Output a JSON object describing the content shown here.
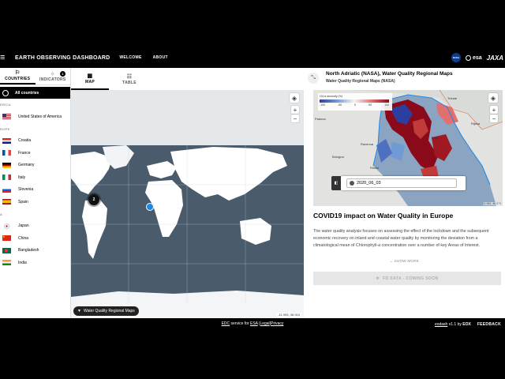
{
  "header": {
    "title": "EARTH OBSERVING DASHBOARD",
    "nav": [
      "WELCOME",
      "ABOUT"
    ],
    "menu_icon": "hamburger-icon",
    "logos": {
      "nasa": "NASA",
      "esa": "esa",
      "jaxa": "JAXA"
    }
  },
  "sidebar": {
    "tabs": [
      {
        "label": "COUNTRIES",
        "icon": "flag-icon"
      },
      {
        "label": "INDICATORS",
        "icon": "lightbulb-icon",
        "badge": "1"
      }
    ],
    "all_label": "All countries",
    "regions": [
      {
        "label": "ERICA",
        "items": [
          {
            "name": "United States of America",
            "flag": "us"
          }
        ]
      },
      {
        "label": "ROPE",
        "items": [
          {
            "name": "Croatia",
            "flag": "hr"
          },
          {
            "name": "France",
            "flag": "fr"
          },
          {
            "name": "Germany",
            "flag": "de"
          },
          {
            "name": "Italy",
            "flag": "it"
          },
          {
            "name": "Slovenia",
            "flag": "si"
          },
          {
            "name": "Spain",
            "flag": "es"
          }
        ]
      },
      {
        "label": "A",
        "items": [
          {
            "name": "Japan",
            "flag": "jp"
          },
          {
            "name": "China",
            "flag": "cn"
          },
          {
            "name": "Bangladesh",
            "flag": "bd"
          },
          {
            "name": "India",
            "flag": "in"
          }
        ]
      }
    ]
  },
  "map": {
    "tabs": [
      {
        "label": "MAP",
        "icon": "map-icon"
      },
      {
        "label": "TABLE",
        "icon": "table-icon"
      }
    ],
    "cluster_count": "2",
    "filter_chip": "Water Quality Regional Maps",
    "coordinates": "-11.953, 36.910",
    "zoom_in": "+",
    "zoom_out": "−"
  },
  "detail": {
    "title": "North Adriatic (NASA), Water Quality Regional Maps",
    "subtitle": "Water Quality Regional Maps (NASA)",
    "legend_title": "Chl-a anomaly (%)",
    "legend_ticks": [
      "-100",
      "-50",
      "0",
      "50",
      "100"
    ],
    "place_labels": [
      "Trieste",
      "Venezia",
      "Padova",
      "Bologna",
      "Ravenna",
      "Rijeka",
      "Pula",
      "Rimini"
    ],
    "date": "2020_06_03",
    "coordinates": "11.961, 45.573",
    "story_title": "COVID19 impact on Water Quality in Europe",
    "story_text": "The water quality analysis focuses on assessing the effect of the lockdown and the subsequent economic recovery on inland and coastal water quality by monitoring the deviation from a climatological mean of Chlorophyll-a concentration over a number of key Areas of Interest.",
    "show_more": "SHOW MORE",
    "fd_button": "FD DATA - COMING SOON"
  },
  "footer": {
    "service_prefix": "EDC",
    "service_mid": " service for ",
    "service_org": "ESA",
    "legal": "Legal",
    "privacy": "Privacy",
    "version_prefix": "eodash",
    "version_suffix": " v1.1 by ",
    "eox": "EOX",
    "feedback": "FEEDBACK"
  },
  "colors": {
    "accent": "#1e88e5",
    "dark": "#000000",
    "ocean": "#47586a",
    "chl_high": "#8b0a1a",
    "chl_low": "#2c3fa0"
  }
}
